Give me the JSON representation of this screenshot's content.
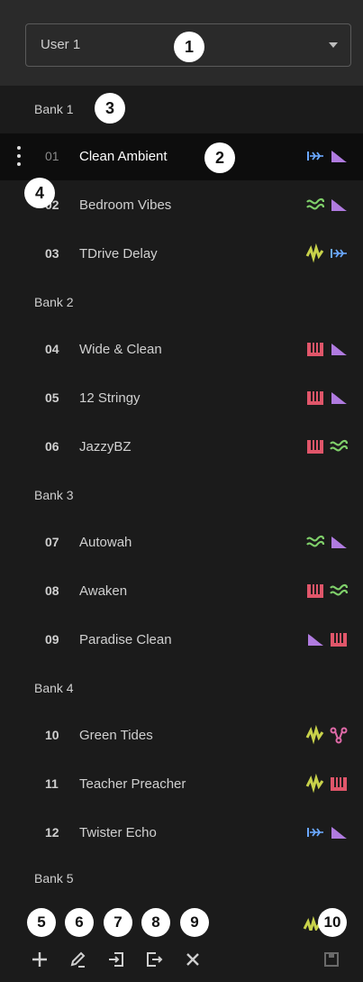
{
  "user_select": {
    "value": "User 1"
  },
  "banks": [
    {
      "label": "Bank 1"
    },
    {
      "label": "Bank 2"
    },
    {
      "label": "Bank 3"
    },
    {
      "label": "Bank 4"
    },
    {
      "label": "Bank 5"
    }
  ],
  "presets": [
    {
      "num": "01",
      "name": "Clean Ambient",
      "icons": [
        "delay-icon",
        "reverb-icon"
      ]
    },
    {
      "num": "02",
      "name": "Bedroom Vibes",
      "icons": [
        "modulation-icon",
        "reverb-icon"
      ]
    },
    {
      "num": "03",
      "name": "TDrive Delay",
      "icons": [
        "drive-icon",
        "delay-icon"
      ]
    },
    {
      "num": "04",
      "name": "Wide & Clean",
      "icons": [
        "amp-icon",
        "reverb-icon"
      ]
    },
    {
      "num": "05",
      "name": "12 Stringy",
      "icons": [
        "amp-icon",
        "reverb-icon"
      ]
    },
    {
      "num": "06",
      "name": "JazzyBZ",
      "icons": [
        "amp-icon",
        "modulation-icon"
      ]
    },
    {
      "num": "07",
      "name": "Autowah",
      "icons": [
        "modulation-icon",
        "reverb-icon"
      ]
    },
    {
      "num": "08",
      "name": "Awaken",
      "icons": [
        "amp-icon",
        "modulation-icon"
      ]
    },
    {
      "num": "09",
      "name": "Paradise Clean",
      "icons": [
        "reverb-icon",
        "amp-icon"
      ]
    },
    {
      "num": "10",
      "name": "Green Tides",
      "icons": [
        "drive-icon",
        "routing-icon"
      ]
    },
    {
      "num": "11",
      "name": "Teacher Preacher",
      "icons": [
        "drive-icon",
        "amp-icon"
      ]
    },
    {
      "num": "12",
      "name": "Twister Echo",
      "icons": [
        "delay-icon",
        "reverb-icon"
      ]
    }
  ],
  "callouts": [
    "1",
    "2",
    "3",
    "4",
    "5",
    "6",
    "7",
    "8",
    "9",
    "10"
  ],
  "colors": {
    "delay": "#6aa8ff",
    "reverb": "#b07be0",
    "modulation": "#7fcf6a",
    "drive": "#c8d24a",
    "amp": "#e0566a",
    "routing": "#e06aa8"
  },
  "toolbar": [
    "add-icon",
    "edit-icon",
    "import-icon",
    "export-icon",
    "delete-icon",
    "save-icon"
  ]
}
